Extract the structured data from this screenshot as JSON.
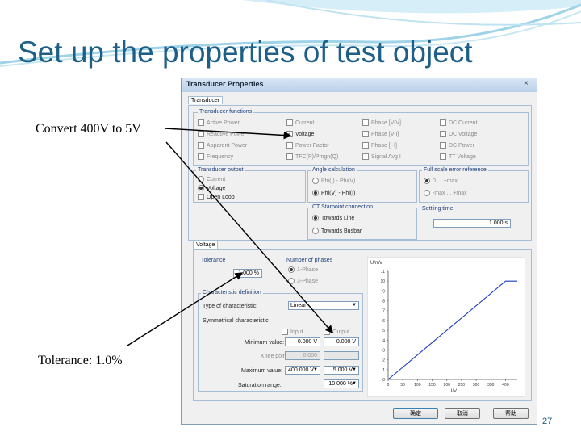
{
  "slide": {
    "title": "Set up the properties of test object",
    "callout_convert": "Convert 400V to 5V",
    "callout_tolerance": "Tolerance: 1.0%",
    "page_number": "27"
  },
  "dialog": {
    "title": "Transducer Properties",
    "close": "×",
    "tab_transducer": "Transducer",
    "functions": {
      "label": "Transducer functions",
      "items": [
        {
          "label": "Active Power",
          "checked": false
        },
        {
          "label": "Current",
          "checked": false
        },
        {
          "label": "Phase [V-V]",
          "checked": false
        },
        {
          "label": "DC Current",
          "checked": false
        },
        {
          "label": "Reactive Power",
          "checked": false
        },
        {
          "label": "Voltage",
          "checked": true
        },
        {
          "label": "Phase [V-I]",
          "checked": false
        },
        {
          "label": "DC Voltage",
          "checked": false
        },
        {
          "label": "Apparent Power",
          "checked": false
        },
        {
          "label": "Power Factor",
          "checked": false
        },
        {
          "label": "Phase [I-I]",
          "checked": false
        },
        {
          "label": "DC Power",
          "checked": false
        },
        {
          "label": "Frequency",
          "checked": false
        },
        {
          "label": "TFC(P)/Pmgn(Q)",
          "checked": false
        },
        {
          "label": "Signal Avg I",
          "checked": false
        },
        {
          "label": "TT Voltage",
          "checked": false
        }
      ]
    },
    "output": {
      "label": "Transducer output",
      "current": "Current",
      "voltage": "Voltage",
      "open_loop": "Open Loop"
    },
    "angle": {
      "label": "Angle calculation",
      "opt1": "Phi(I) - Phi(V)",
      "opt2": "Phi(V) - Phi(I)"
    },
    "fullscale": {
      "label": "Full scale error reference",
      "opt1": "0 ... +max",
      "opt2": "-max ... +max"
    },
    "ct": {
      "label": "CT Starpoint connection",
      "opt1": "Towards Line",
      "opt2": "Towards Busbar"
    },
    "settling": {
      "label": "Settling time",
      "value": "1.000 s"
    },
    "tab_voltage": "Voltage",
    "tolerance": {
      "label": "Tolerance",
      "value": "1.000 %"
    },
    "phases": {
      "label": "Number of phases",
      "opt1": "1-Phase",
      "opt2": "3-Phase"
    },
    "characteristic": {
      "group_label": "Characteristic definition",
      "type_label": "Type of characteristic:",
      "type_value": "Linear",
      "symmetrical_label": "Symmetrical characteristic",
      "input_label": "Input",
      "output_label": "Output",
      "min_label": "Minimum value:",
      "min_input": "0.000 V",
      "min_output": "0.000 V",
      "knee_label": "Knee point:",
      "knee_value": "0.000",
      "max_label": "Maximum value:",
      "max_input": "400.000 V",
      "max_output": "5.000 V",
      "sat_label": "Saturation range:",
      "sat_value": "10.000 %"
    },
    "buttons": {
      "ok": "确定",
      "cancel": "取消",
      "help": "帮助"
    }
  },
  "chart_data": {
    "type": "line",
    "title": "",
    "ylabel": "U/mV",
    "xlabel": "U/V",
    "xlim": [
      0,
      440
    ],
    "ylim": [
      0,
      11
    ],
    "x_ticks": [
      0,
      50,
      100,
      150,
      200,
      250,
      300,
      350,
      400
    ],
    "y_ticks": [
      0,
      1,
      2,
      3,
      4,
      5,
      6,
      7,
      8,
      9,
      10,
      11
    ],
    "grid": false,
    "series": [
      {
        "x": [
          0,
          400,
          440
        ],
        "y": [
          0,
          10,
          10
        ]
      }
    ]
  },
  "colors": {
    "title": "#1d5f86",
    "line": "#1f3fbf",
    "dialog_border": "#7f9db9"
  }
}
